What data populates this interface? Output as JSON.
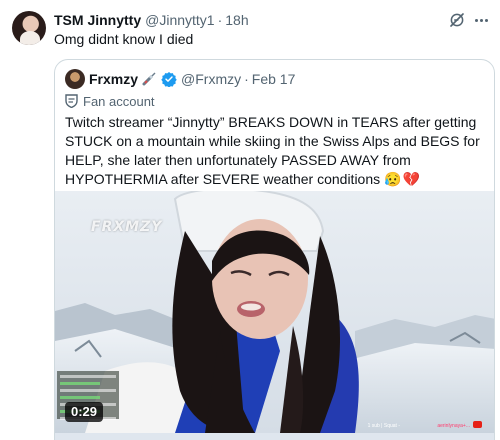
{
  "tweet": {
    "display_name": "TSM Jinnytty",
    "handle": "@Jinnytty1",
    "separator": "·",
    "time": "18h",
    "text": "Omg didnt know I died",
    "grok_icon": "grok-icon",
    "more_icon": "more-icon"
  },
  "quote": {
    "display_name": "Frxmzy",
    "name_emoji": "syringe-emoji",
    "verified_icon": "verified-icon",
    "handle": "@Frxmzy",
    "separator": "·",
    "date": "Feb 17",
    "label": "Fan account",
    "label_icon": "fan-account-icon",
    "text": "Twitch streamer “Jinnytty” BREAKS DOWN in TEARS after getting STUCK on a mountain while skiing in the Swiss Alps and BEGS for HELP, she later then unfortunately PASSED AWAY from HYPOTHERMIA after SEVERE weather conditions",
    "text_emojis": "😥💔",
    "media": {
      "watermark": "FRXMZY",
      "duration": "0:29",
      "stream_caption": "1 sub | Squat -",
      "stream_tag": "aerinlynaya+..."
    }
  },
  "colors": {
    "text_primary": "#0f1419",
    "text_secondary": "#536471",
    "border": "#cfd9de",
    "verified": "#1d9bf0"
  }
}
